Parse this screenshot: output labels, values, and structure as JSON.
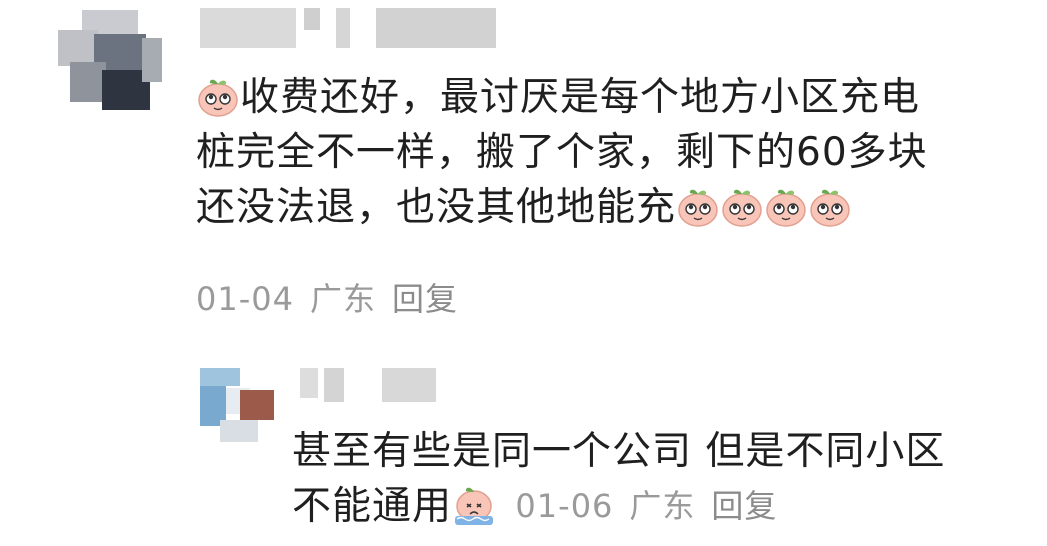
{
  "comment": {
    "avatar": "avatar-icon",
    "emoji": "peach-face-emoji",
    "text_lines": [
      "收费还好，最讨厌是每个地方小区充电",
      "桩完全不一样，搬了个家，剩下的60多块",
      "还没法退，也没其他地能充"
    ],
    "meta": {
      "date": "01-04",
      "location": "广东",
      "reply_label": "回复"
    }
  },
  "reply": {
    "avatar": "avatar-icon",
    "emoji": "crying-peach-emoji",
    "text_lines": [
      "甚至有些是同一个公司 但是不同小区",
      "不能通用"
    ],
    "meta": {
      "date": "01-06",
      "location": "广东",
      "reply_label": "回复"
    }
  },
  "colors": {
    "meta_text": "#9a9a9a",
    "body_text": "#1f1f1f",
    "emoji_peach": "#f7c0b4",
    "emoji_leaf": "#6aa84f"
  }
}
